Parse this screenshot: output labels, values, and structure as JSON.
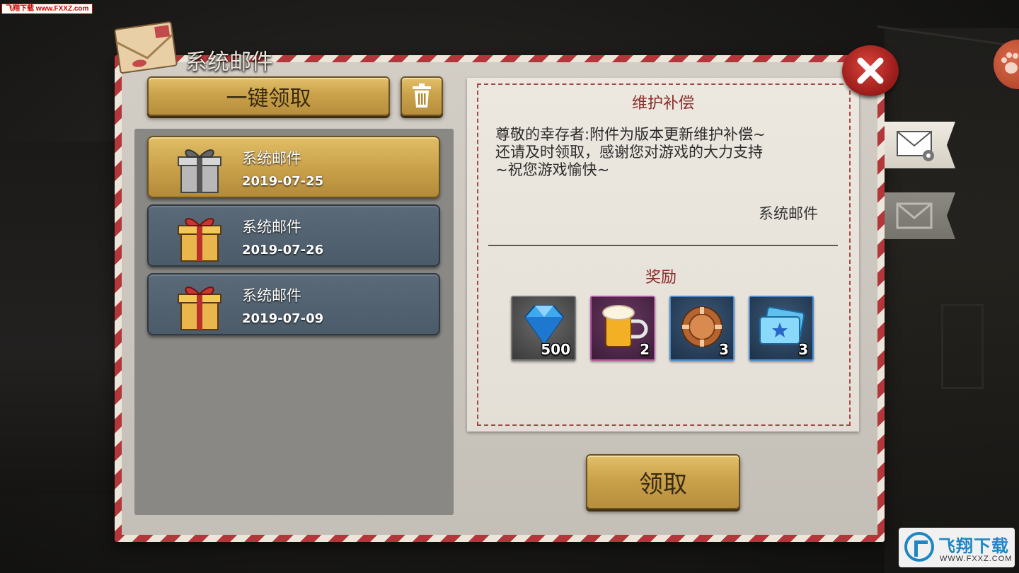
{
  "watermark": {
    "top_left": "飞翔下载 www.FXXZ.com",
    "brand": "飞翔下载",
    "brand_url": "WWW.FXXZ.COM"
  },
  "window": {
    "title": "系统邮件",
    "close_icon": "close-icon"
  },
  "toolbar": {
    "claim_all_label": "一键领取",
    "delete_icon": "trash-icon"
  },
  "mail_list": [
    {
      "title": "系统邮件",
      "date": "2019-07-25",
      "icon": "gift-silver-icon",
      "selected": true
    },
    {
      "title": "系统邮件",
      "date": "2019-07-26",
      "icon": "gift-red-icon",
      "selected": false
    },
    {
      "title": "系统邮件",
      "date": "2019-07-09",
      "icon": "gift-red-icon",
      "selected": false
    }
  ],
  "detail": {
    "title": "维护补偿",
    "body_lines": [
      "尊敬的幸存者:附件为版本更新维护补偿~",
      "还请及时领取，感谢您对游戏的大力支持",
      "~祝您游戏愉快~"
    ],
    "sender": "系统邮件",
    "rewards_title": "奖励",
    "rewards": [
      {
        "icon": "diamond-icon",
        "count": "500"
      },
      {
        "icon": "beer-icon",
        "count": "2"
      },
      {
        "icon": "chip-icon",
        "count": "3"
      },
      {
        "icon": "ticket-icon",
        "count": "3"
      }
    ]
  },
  "claim_label": "领取",
  "side_tabs": [
    {
      "icon": "system-mail-icon",
      "active": true
    },
    {
      "icon": "mail-icon",
      "active": false
    }
  ],
  "colors": {
    "gold": "#caa24b",
    "selected_item": "#c9a04a",
    "unselected_item": "#4c5b69",
    "accent_red": "#8a2c2a",
    "close_red": "#a2201d"
  }
}
